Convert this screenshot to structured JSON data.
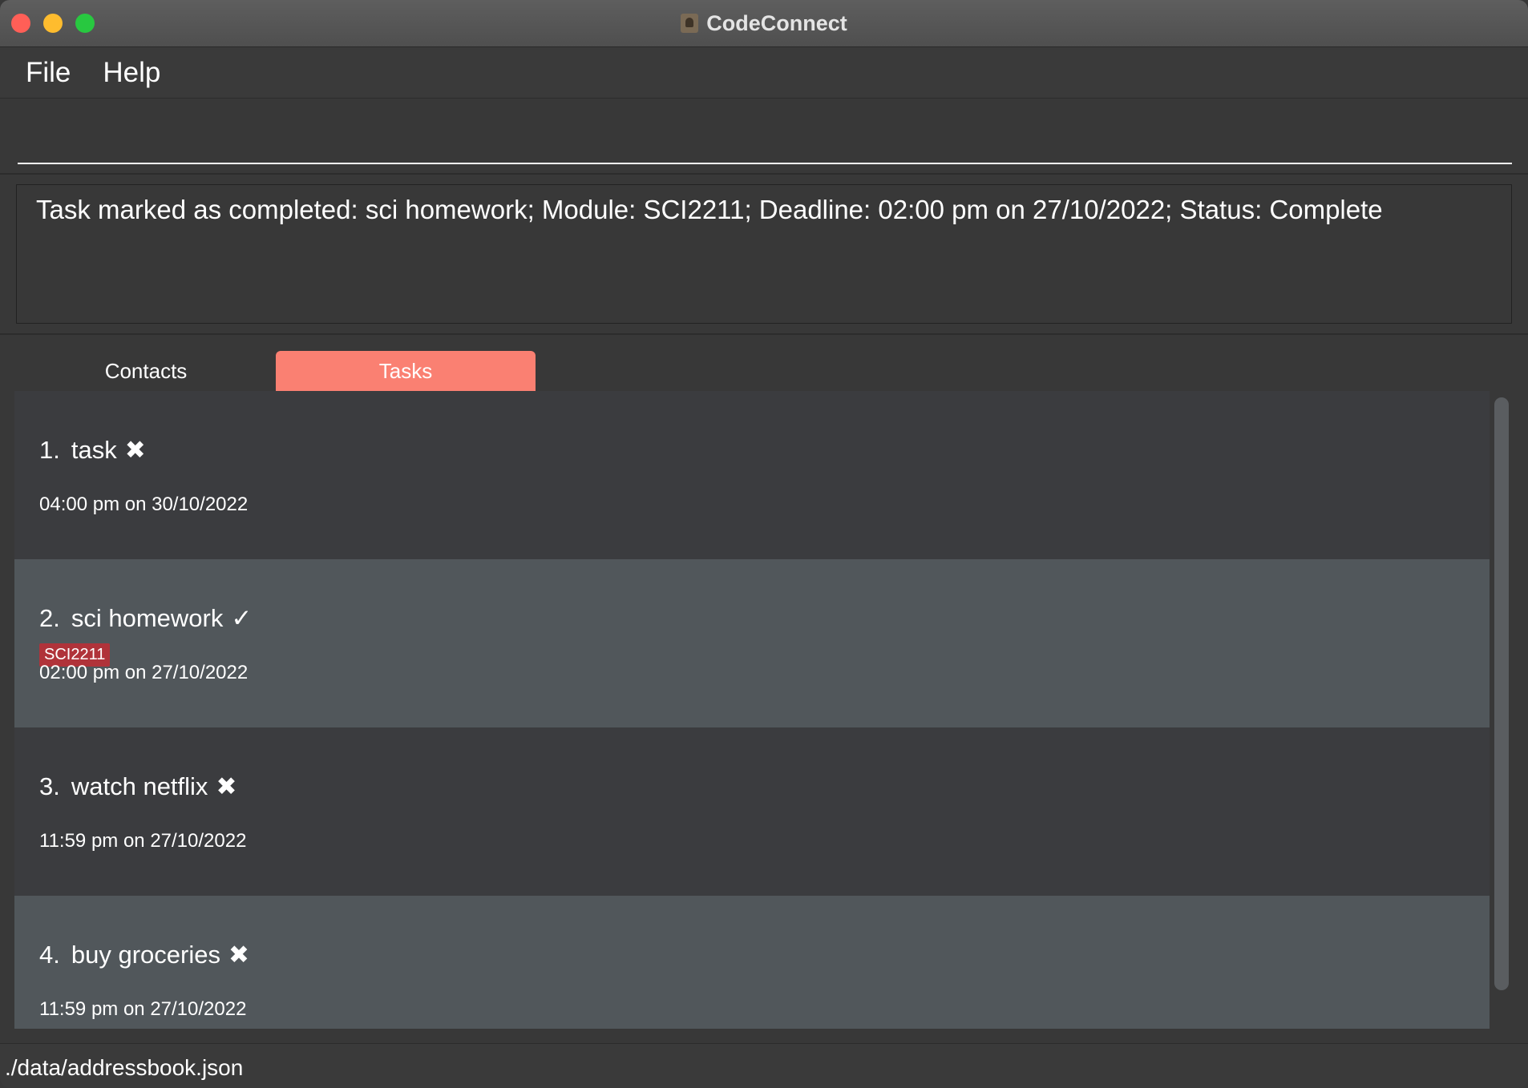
{
  "window": {
    "title": "CodeConnect"
  },
  "menu": {
    "file_label": "File",
    "help_label": "Help"
  },
  "command": {
    "value": "",
    "placeholder": ""
  },
  "result": {
    "message": "Task marked as completed: sci homework; Module: SCI2211; Deadline: 02:00 pm on 27/10/2022; Status: Complete"
  },
  "tabs": [
    {
      "label": "Contacts",
      "active": false
    },
    {
      "label": "Tasks",
      "active": true
    }
  ],
  "tasks": [
    {
      "index": "1.",
      "name": "task",
      "status_mark": "✖",
      "tag": "",
      "deadline": "04:00 pm on 30/10/2022"
    },
    {
      "index": "2.",
      "name": "sci homework",
      "status_mark": "✓",
      "tag": "SCI2211",
      "deadline": "02:00 pm on 27/10/2022"
    },
    {
      "index": "3.",
      "name": "watch netflix",
      "status_mark": "✖",
      "tag": "",
      "deadline": "11:59 pm on 27/10/2022"
    },
    {
      "index": "4.",
      "name": "buy groceries",
      "status_mark": "✖",
      "tag": "",
      "deadline": "11:59 pm on 27/10/2022"
    }
  ],
  "status_bar": {
    "path": "./data/addressbook.json"
  },
  "colors": {
    "accent_tab": "#fa8072",
    "tag_background": "#b0333a"
  }
}
